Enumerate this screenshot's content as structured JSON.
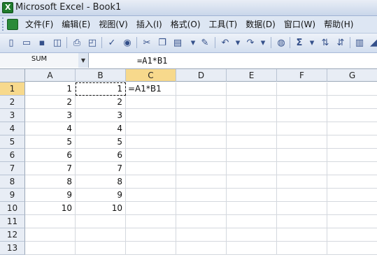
{
  "window": {
    "title": "Microsoft Excel - Book1",
    "app_icon": "excel-icon"
  },
  "menubar": {
    "items": [
      "文件(F)",
      "编辑(E)",
      "视图(V)",
      "插入(I)",
      "格式(O)",
      "工具(T)",
      "数据(D)",
      "窗口(W)",
      "帮助(H)"
    ]
  },
  "toolbar": {
    "buttons": [
      "new-icon",
      "open-icon",
      "save-icon",
      "permission-icon",
      "print-icon",
      "print-preview-icon",
      "spelling-icon",
      "research-icon",
      "cut-icon",
      "copy-icon",
      "paste-icon",
      "format-painter-icon",
      "undo-icon",
      "redo-icon",
      "hyperlink-icon",
      "autosum-icon",
      "sort-ascending-icon",
      "sort-descending-icon",
      "chart-wizard-icon",
      "drawing-icon"
    ]
  },
  "formula_bar": {
    "name_box": "SUM",
    "formula": "=A1*B1"
  },
  "sheet": {
    "columns": [
      "A",
      "B",
      "C",
      "D",
      "E",
      "F",
      "G"
    ],
    "rows": [
      "1",
      "2",
      "3",
      "4",
      "5",
      "6",
      "7",
      "8",
      "9",
      "10",
      "11",
      "12",
      "13"
    ],
    "active_column": "C",
    "active_row": "1",
    "cells": {
      "A": [
        "1",
        "2",
        "3",
        "4",
        "5",
        "6",
        "7",
        "8",
        "9",
        "10",
        "",
        "",
        ""
      ],
      "B": [
        "1",
        "2",
        "3",
        "4",
        "5",
        "6",
        "7",
        "8",
        "9",
        "10",
        "",
        "",
        ""
      ],
      "C": [
        "=A1*B1",
        "",
        "",
        "",
        "",
        "",
        "",
        "",
        "",
        "",
        "",
        "",
        ""
      ]
    }
  }
}
